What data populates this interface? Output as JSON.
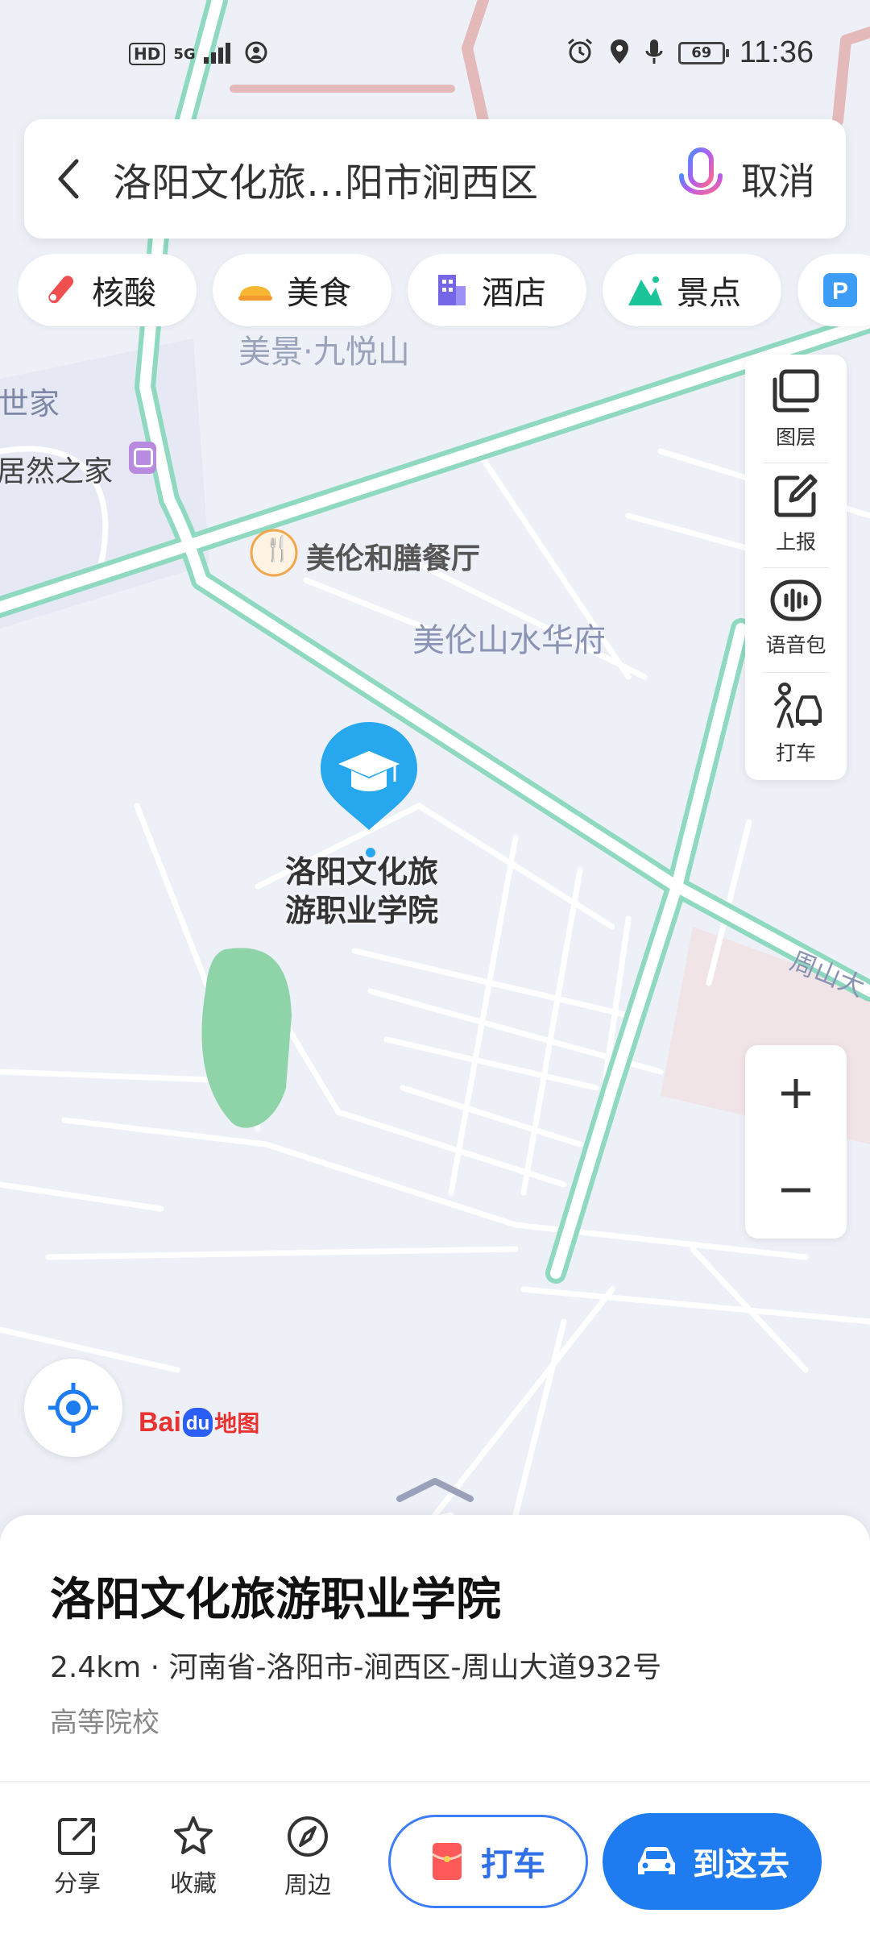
{
  "status_bar": {
    "hd": "HD",
    "network": "5G",
    "battery": "69",
    "time": "11:36"
  },
  "search": {
    "query": "洛阳文化旅…阳市涧西区",
    "cancel_label": "取消"
  },
  "categories": [
    {
      "label": "核酸",
      "icon": "test-tube-icon"
    },
    {
      "label": "美食",
      "icon": "food-icon"
    },
    {
      "label": "酒店",
      "icon": "hotel-icon"
    },
    {
      "label": "景点",
      "icon": "scenery-icon"
    }
  ],
  "toolbar": {
    "layers": "图层",
    "report": "上报",
    "voice": "语音包",
    "taxi": "打车"
  },
  "map": {
    "labels": {
      "jiuyue": "美景·九悦山",
      "shijia": "世家",
      "juran": "居然之家",
      "restaurant": "美伦和膳餐厅",
      "huafu": "美伦山水华府",
      "zhoushan": "周山大",
      "school_line1": "洛阳文化旅",
      "school_line2": "游职业学院"
    }
  },
  "logo": {
    "bai": "Bai",
    "du": "du",
    "ditu": "地图"
  },
  "place": {
    "name": "洛阳文化旅游职业学院",
    "address": "2.4km · 河南省-洛阳市-涧西区-周山大道932号",
    "type": "高等院校"
  },
  "actions": {
    "share": "分享",
    "favorite": "收藏",
    "nearby": "周边",
    "taxi": "打车",
    "go": "到这去"
  },
  "colors": {
    "map_background": "#eef0f8",
    "road_fill": "#ffffff",
    "road_green": "#8ed9c0",
    "accent_blue": "#1f7cf0",
    "marker_blue": "#26a7ee",
    "park_green": "#8fd4a8"
  }
}
